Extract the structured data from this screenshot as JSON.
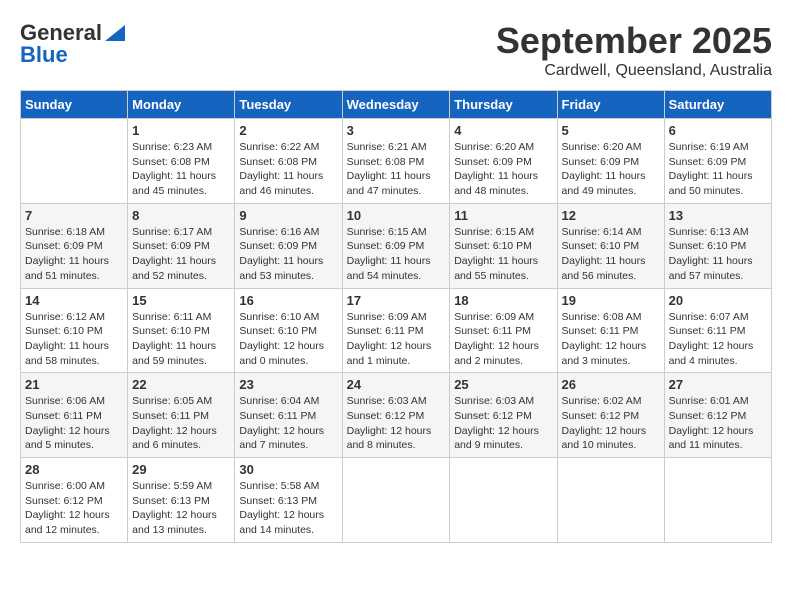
{
  "header": {
    "logo_general": "General",
    "logo_blue": "Blue",
    "month_title": "September 2025",
    "subtitle": "Cardwell, Queensland, Australia"
  },
  "columns": [
    "Sunday",
    "Monday",
    "Tuesday",
    "Wednesday",
    "Thursday",
    "Friday",
    "Saturday"
  ],
  "weeks": [
    [
      {
        "day": "",
        "info": ""
      },
      {
        "day": "1",
        "info": "Sunrise: 6:23 AM\nSunset: 6:08 PM\nDaylight: 11 hours\nand 45 minutes."
      },
      {
        "day": "2",
        "info": "Sunrise: 6:22 AM\nSunset: 6:08 PM\nDaylight: 11 hours\nand 46 minutes."
      },
      {
        "day": "3",
        "info": "Sunrise: 6:21 AM\nSunset: 6:08 PM\nDaylight: 11 hours\nand 47 minutes."
      },
      {
        "day": "4",
        "info": "Sunrise: 6:20 AM\nSunset: 6:09 PM\nDaylight: 11 hours\nand 48 minutes."
      },
      {
        "day": "5",
        "info": "Sunrise: 6:20 AM\nSunset: 6:09 PM\nDaylight: 11 hours\nand 49 minutes."
      },
      {
        "day": "6",
        "info": "Sunrise: 6:19 AM\nSunset: 6:09 PM\nDaylight: 11 hours\nand 50 minutes."
      }
    ],
    [
      {
        "day": "7",
        "info": "Sunrise: 6:18 AM\nSunset: 6:09 PM\nDaylight: 11 hours\nand 51 minutes."
      },
      {
        "day": "8",
        "info": "Sunrise: 6:17 AM\nSunset: 6:09 PM\nDaylight: 11 hours\nand 52 minutes."
      },
      {
        "day": "9",
        "info": "Sunrise: 6:16 AM\nSunset: 6:09 PM\nDaylight: 11 hours\nand 53 minutes."
      },
      {
        "day": "10",
        "info": "Sunrise: 6:15 AM\nSunset: 6:09 PM\nDaylight: 11 hours\nand 54 minutes."
      },
      {
        "day": "11",
        "info": "Sunrise: 6:15 AM\nSunset: 6:10 PM\nDaylight: 11 hours\nand 55 minutes."
      },
      {
        "day": "12",
        "info": "Sunrise: 6:14 AM\nSunset: 6:10 PM\nDaylight: 11 hours\nand 56 minutes."
      },
      {
        "day": "13",
        "info": "Sunrise: 6:13 AM\nSunset: 6:10 PM\nDaylight: 11 hours\nand 57 minutes."
      }
    ],
    [
      {
        "day": "14",
        "info": "Sunrise: 6:12 AM\nSunset: 6:10 PM\nDaylight: 11 hours\nand 58 minutes."
      },
      {
        "day": "15",
        "info": "Sunrise: 6:11 AM\nSunset: 6:10 PM\nDaylight: 11 hours\nand 59 minutes."
      },
      {
        "day": "16",
        "info": "Sunrise: 6:10 AM\nSunset: 6:10 PM\nDaylight: 12 hours\nand 0 minutes."
      },
      {
        "day": "17",
        "info": "Sunrise: 6:09 AM\nSunset: 6:11 PM\nDaylight: 12 hours\nand 1 minute."
      },
      {
        "day": "18",
        "info": "Sunrise: 6:09 AM\nSunset: 6:11 PM\nDaylight: 12 hours\nand 2 minutes."
      },
      {
        "day": "19",
        "info": "Sunrise: 6:08 AM\nSunset: 6:11 PM\nDaylight: 12 hours\nand 3 minutes."
      },
      {
        "day": "20",
        "info": "Sunrise: 6:07 AM\nSunset: 6:11 PM\nDaylight: 12 hours\nand 4 minutes."
      }
    ],
    [
      {
        "day": "21",
        "info": "Sunrise: 6:06 AM\nSunset: 6:11 PM\nDaylight: 12 hours\nand 5 minutes."
      },
      {
        "day": "22",
        "info": "Sunrise: 6:05 AM\nSunset: 6:11 PM\nDaylight: 12 hours\nand 6 minutes."
      },
      {
        "day": "23",
        "info": "Sunrise: 6:04 AM\nSunset: 6:11 PM\nDaylight: 12 hours\nand 7 minutes."
      },
      {
        "day": "24",
        "info": "Sunrise: 6:03 AM\nSunset: 6:12 PM\nDaylight: 12 hours\nand 8 minutes."
      },
      {
        "day": "25",
        "info": "Sunrise: 6:03 AM\nSunset: 6:12 PM\nDaylight: 12 hours\nand 9 minutes."
      },
      {
        "day": "26",
        "info": "Sunrise: 6:02 AM\nSunset: 6:12 PM\nDaylight: 12 hours\nand 10 minutes."
      },
      {
        "day": "27",
        "info": "Sunrise: 6:01 AM\nSunset: 6:12 PM\nDaylight: 12 hours\nand 11 minutes."
      }
    ],
    [
      {
        "day": "28",
        "info": "Sunrise: 6:00 AM\nSunset: 6:12 PM\nDaylight: 12 hours\nand 12 minutes."
      },
      {
        "day": "29",
        "info": "Sunrise: 5:59 AM\nSunset: 6:13 PM\nDaylight: 12 hours\nand 13 minutes."
      },
      {
        "day": "30",
        "info": "Sunrise: 5:58 AM\nSunset: 6:13 PM\nDaylight: 12 hours\nand 14 minutes."
      },
      {
        "day": "",
        "info": ""
      },
      {
        "day": "",
        "info": ""
      },
      {
        "day": "",
        "info": ""
      },
      {
        "day": "",
        "info": ""
      }
    ]
  ]
}
